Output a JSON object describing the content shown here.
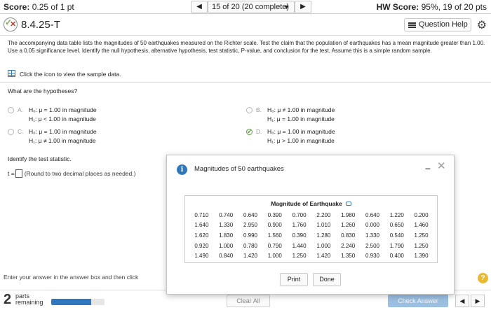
{
  "topbar": {
    "score_label": "Score:",
    "score_value": "0.25 of 1 pt",
    "question_nav": "15 of 20 (20 complete)",
    "hw_label": "HW Score:",
    "hw_value": "95%, 19 of 20 pts"
  },
  "question": {
    "id": "8.4.25-T",
    "help_label": "Question Help"
  },
  "problem": {
    "text": "The accompanying data table lists the magnitudes of 50 earthquakes measured on the Richter scale. Test the claim that the population of earthquakes has a mean magnitude greater than 1.00. Use a 0.05 significance level. Identify the null hypothesis, alternative hypothesis, test statistic, P-value, and conclusion for the test. Assume this is a simple random sample.",
    "sample_link": "Click the icon to view the sample data."
  },
  "hypotheses": {
    "question": "What are the hypotheses?",
    "options": [
      {
        "letter": "A.",
        "h0": "H₀: μ = 1.00 in magnitude",
        "h1": "H₁: μ < 1.00 in magnitude",
        "selected": false
      },
      {
        "letter": "B.",
        "h0": "H₀: μ ≠ 1.00 in magnitude",
        "h1": "H₁: μ = 1.00 in magnitude",
        "selected": false
      },
      {
        "letter": "C.",
        "h0": "H₀: μ = 1.00 in magnitude",
        "h1": "H₁: μ ≠ 1.00 in magnitude",
        "selected": false
      },
      {
        "letter": "D.",
        "h0": "H₀: μ = 1.00 in magnitude",
        "h1": "H₁: μ > 1.00 in magnitude",
        "selected": true
      }
    ]
  },
  "test_statistic": {
    "question": "Identify the test statistic.",
    "prefix": "t =",
    "value": "",
    "hint": "(Round to two decimal places as needed.)"
  },
  "footer": {
    "instruction": "Enter your answer in the answer box and then click",
    "parts_count": "2",
    "parts_label_1": "parts",
    "parts_label_2": "remaining",
    "progress_fraction": 0.75,
    "clear_label": "Clear All",
    "check_label": "Check Answer"
  },
  "dialog": {
    "title": "Magnitudes of 50 earthquakes",
    "table_caption": "Magnitude of Earthquake",
    "rows": [
      [
        "0.710",
        "0.740",
        "0.640",
        "0.390",
        "0.700",
        "2.200",
        "1.980",
        "0.640",
        "1.220",
        "0.200"
      ],
      [
        "1.640",
        "1.330",
        "2.950",
        "0.900",
        "1.760",
        "1.010",
        "1.260",
        "0.000",
        "0.650",
        "1.460"
      ],
      [
        "1.620",
        "1.830",
        "0.990",
        "1.560",
        "0.390",
        "1.280",
        "0.830",
        "1.330",
        "0.540",
        "1.250"
      ],
      [
        "0.920",
        "1.000",
        "0.780",
        "0.790",
        "1.440",
        "1.000",
        "2.240",
        "2.500",
        "1.790",
        "1.250"
      ],
      [
        "1.490",
        "0.840",
        "1.420",
        "1.000",
        "1.250",
        "1.420",
        "1.350",
        "0.930",
        "0.400",
        "1.390"
      ]
    ],
    "print_label": "Print",
    "done_label": "Done"
  }
}
